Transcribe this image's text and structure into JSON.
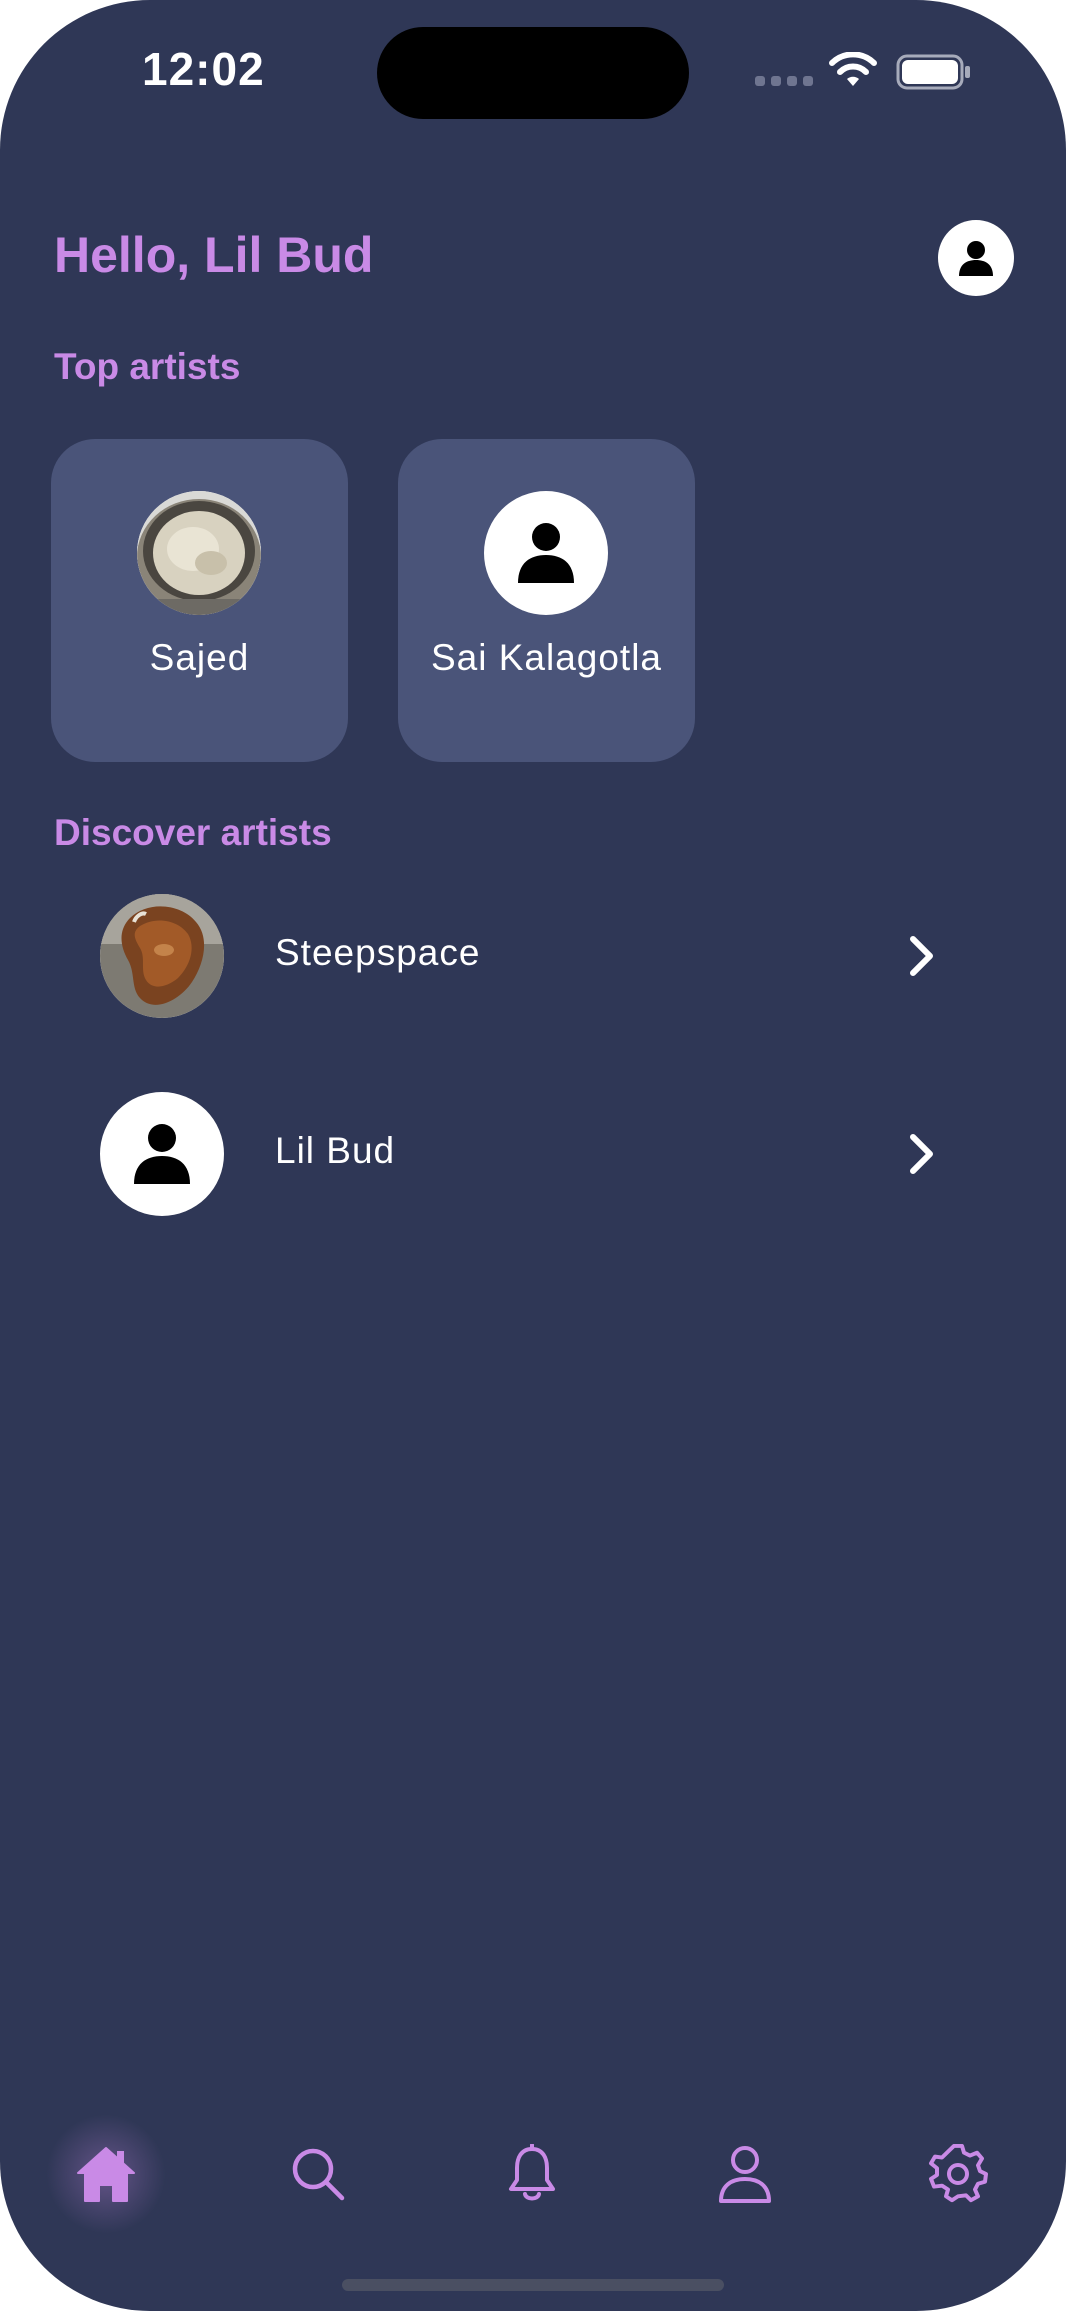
{
  "status_bar": {
    "time": "12:02"
  },
  "header": {
    "greeting": "Hello, Lil Bud",
    "profile_icon": "person-icon"
  },
  "top_artists": {
    "title": "Top artists",
    "items": [
      {
        "name": "Sajed",
        "avatar": "photo-pot"
      },
      {
        "name": "Sai Kalagotla",
        "avatar": "person-icon"
      }
    ]
  },
  "discover_artists": {
    "title": "Discover artists",
    "items": [
      {
        "name": "Steepspace",
        "avatar": "photo-cooked-meat",
        "action_icon": "chevron-right-icon"
      },
      {
        "name": "Lil Bud",
        "avatar": "person-icon",
        "action_icon": "chevron-right-icon"
      }
    ]
  },
  "tab_bar": {
    "items": [
      {
        "icon": "home-icon",
        "active": true
      },
      {
        "icon": "search-icon",
        "active": false
      },
      {
        "icon": "bell-icon",
        "active": false
      },
      {
        "icon": "profile-icon",
        "active": false
      },
      {
        "icon": "gear-icon",
        "active": false
      }
    ]
  },
  "colors": {
    "background": "#2f3756",
    "card": "#4a5479",
    "accent": "#c98ae6",
    "text": "#ffffff"
  }
}
